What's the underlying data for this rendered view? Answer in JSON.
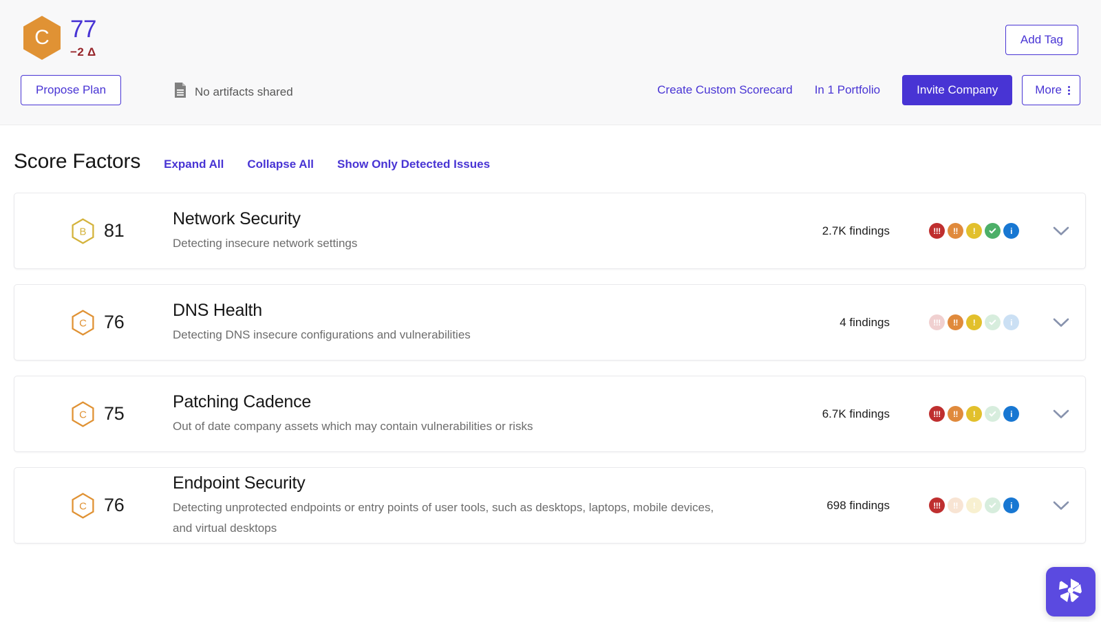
{
  "header": {
    "company_grade": "C",
    "company_grade_color": "#e09234",
    "score": "77",
    "score_delta": "−2 Δ",
    "add_tag_label": "Add Tag",
    "propose_plan_label": "Propose Plan",
    "artifacts_icon": "document-icon",
    "artifacts_label": "No artifacts shared",
    "create_scorecard_label": "Create Custom Scorecard",
    "portfolio_label": "In 1 Portfolio",
    "invite_label": "Invite Company",
    "more_label": "More",
    "accent_color": "#4834d4"
  },
  "section": {
    "title": "Score Factors",
    "links": [
      {
        "label": "Expand All"
      },
      {
        "label": "Collapse All"
      },
      {
        "label": "Show Only Detected Issues"
      }
    ]
  },
  "severity_colors": {
    "critical": "#bf2f2f",
    "high": "#e08a3c",
    "medium": "#e2c02c",
    "low": "#4caf68",
    "info": "#1877d2"
  },
  "factors": [
    {
      "grade": "B",
      "grade_color": "#d4b33c",
      "score": "81",
      "title": "Network Security",
      "description": "Detecting insecure network settings",
      "findings": "2.7K findings",
      "severities": [
        {
          "key": "critical",
          "glyph": "!!!",
          "active": true
        },
        {
          "key": "high",
          "glyph": "!!",
          "active": true
        },
        {
          "key": "medium",
          "glyph": "!",
          "active": true
        },
        {
          "key": "low",
          "glyph": "check",
          "active": true
        },
        {
          "key": "info",
          "glyph": "i",
          "active": true
        }
      ]
    },
    {
      "grade": "C",
      "grade_color": "#e09234",
      "score": "76",
      "title": "DNS Health",
      "description": "Detecting DNS insecure configurations and vulnerabilities",
      "findings": "4 findings",
      "severities": [
        {
          "key": "critical",
          "glyph": "!!!",
          "active": false
        },
        {
          "key": "high",
          "glyph": "!!",
          "active": true
        },
        {
          "key": "medium",
          "glyph": "!",
          "active": true
        },
        {
          "key": "low",
          "glyph": "check",
          "active": false
        },
        {
          "key": "info",
          "glyph": "i",
          "active": false
        }
      ]
    },
    {
      "grade": "C",
      "grade_color": "#e09234",
      "score": "75",
      "title": "Patching Cadence",
      "description": "Out of date company assets which may contain vulnerabilities or risks",
      "findings": "6.7K findings",
      "severities": [
        {
          "key": "critical",
          "glyph": "!!!",
          "active": true
        },
        {
          "key": "high",
          "glyph": "!!",
          "active": true
        },
        {
          "key": "medium",
          "glyph": "!",
          "active": true
        },
        {
          "key": "low",
          "glyph": "check",
          "active": false
        },
        {
          "key": "info",
          "glyph": "i",
          "active": true
        }
      ]
    },
    {
      "grade": "C",
      "grade_color": "#e09234",
      "score": "76",
      "title": "Endpoint Security",
      "description": "Detecting unprotected endpoints or entry points of user tools, such as desktops, laptops, mobile devices, and virtual desktops",
      "findings": "698 findings",
      "severities": [
        {
          "key": "critical",
          "glyph": "!!!",
          "active": true
        },
        {
          "key": "high",
          "glyph": "!!",
          "active": false
        },
        {
          "key": "medium",
          "glyph": "!",
          "active": false
        },
        {
          "key": "low",
          "glyph": "check",
          "active": false
        },
        {
          "key": "info",
          "glyph": "i",
          "active": true
        }
      ]
    }
  ],
  "floating_widget": {
    "icon": "hexagon-aperture-logo-icon",
    "color": "#5b4ae0"
  }
}
